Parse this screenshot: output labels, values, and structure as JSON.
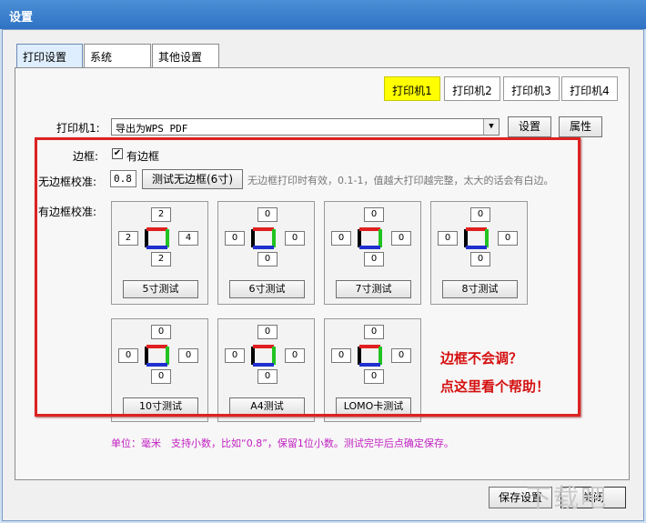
{
  "window": {
    "title": "设置"
  },
  "tabs": [
    {
      "label": "打印设置",
      "active": true
    },
    {
      "label": "系统",
      "active": false
    },
    {
      "label": "其他设置",
      "active": false
    }
  ],
  "printer_tabs": [
    {
      "label": "打印机1",
      "active": true
    },
    {
      "label": "打印机2",
      "active": false
    },
    {
      "label": "打印机3",
      "active": false
    },
    {
      "label": "打印机4",
      "active": false
    }
  ],
  "printer_row": {
    "label": "打印机1:",
    "selected": "导出为WPS PDF",
    "settings_button": "设置",
    "properties_button": "属性"
  },
  "border": {
    "label": "边框:",
    "checkbox_label": "有边框",
    "checked": true
  },
  "borderless": {
    "label": "无边框校准:",
    "value": "0.8",
    "test_button": "测试无边框(6寸)",
    "hint": "无边框打印时有效，0.1-1，值越大打印越完整，太大的话会有白边。"
  },
  "bordered": {
    "label": "有边框校准:",
    "cards": [
      {
        "top": "2",
        "left": "2",
        "right": "4",
        "bottom": "2",
        "button": "5寸测试"
      },
      {
        "top": "0",
        "left": "0",
        "right": "0",
        "bottom": "0",
        "button": "6寸测试"
      },
      {
        "top": "0",
        "left": "0",
        "right": "0",
        "bottom": "0",
        "button": "7寸测试"
      },
      {
        "top": "0",
        "left": "0",
        "right": "0",
        "bottom": "0",
        "button": "8寸测试"
      },
      {
        "top": "0",
        "left": "0",
        "right": "0",
        "bottom": "0",
        "button": "10寸测试"
      },
      {
        "top": "0",
        "left": "0",
        "right": "0",
        "bottom": "0",
        "button": "A4测试"
      },
      {
        "top": "0",
        "left": "0",
        "right": "0",
        "bottom": "0",
        "button": "LOMO卡测试"
      }
    ]
  },
  "help": {
    "line1": "边框不会调？",
    "line2": "点这里看个帮助！"
  },
  "unit_note": "单位：毫米　支持小数，比如“0.8”，保留1位小数。测试完毕后点确定保存。",
  "footer": {
    "save_button": "保存设置",
    "close_button": "关闭"
  },
  "watermark": "下载吧",
  "colors": {
    "active_tab_yellow": "#ffff00",
    "highlight_red": "#dd2222",
    "note_magenta": "#c11fc1",
    "diagram_red": "#e02020",
    "diagram_green": "#22c322",
    "diagram_blue": "#2030d0"
  }
}
